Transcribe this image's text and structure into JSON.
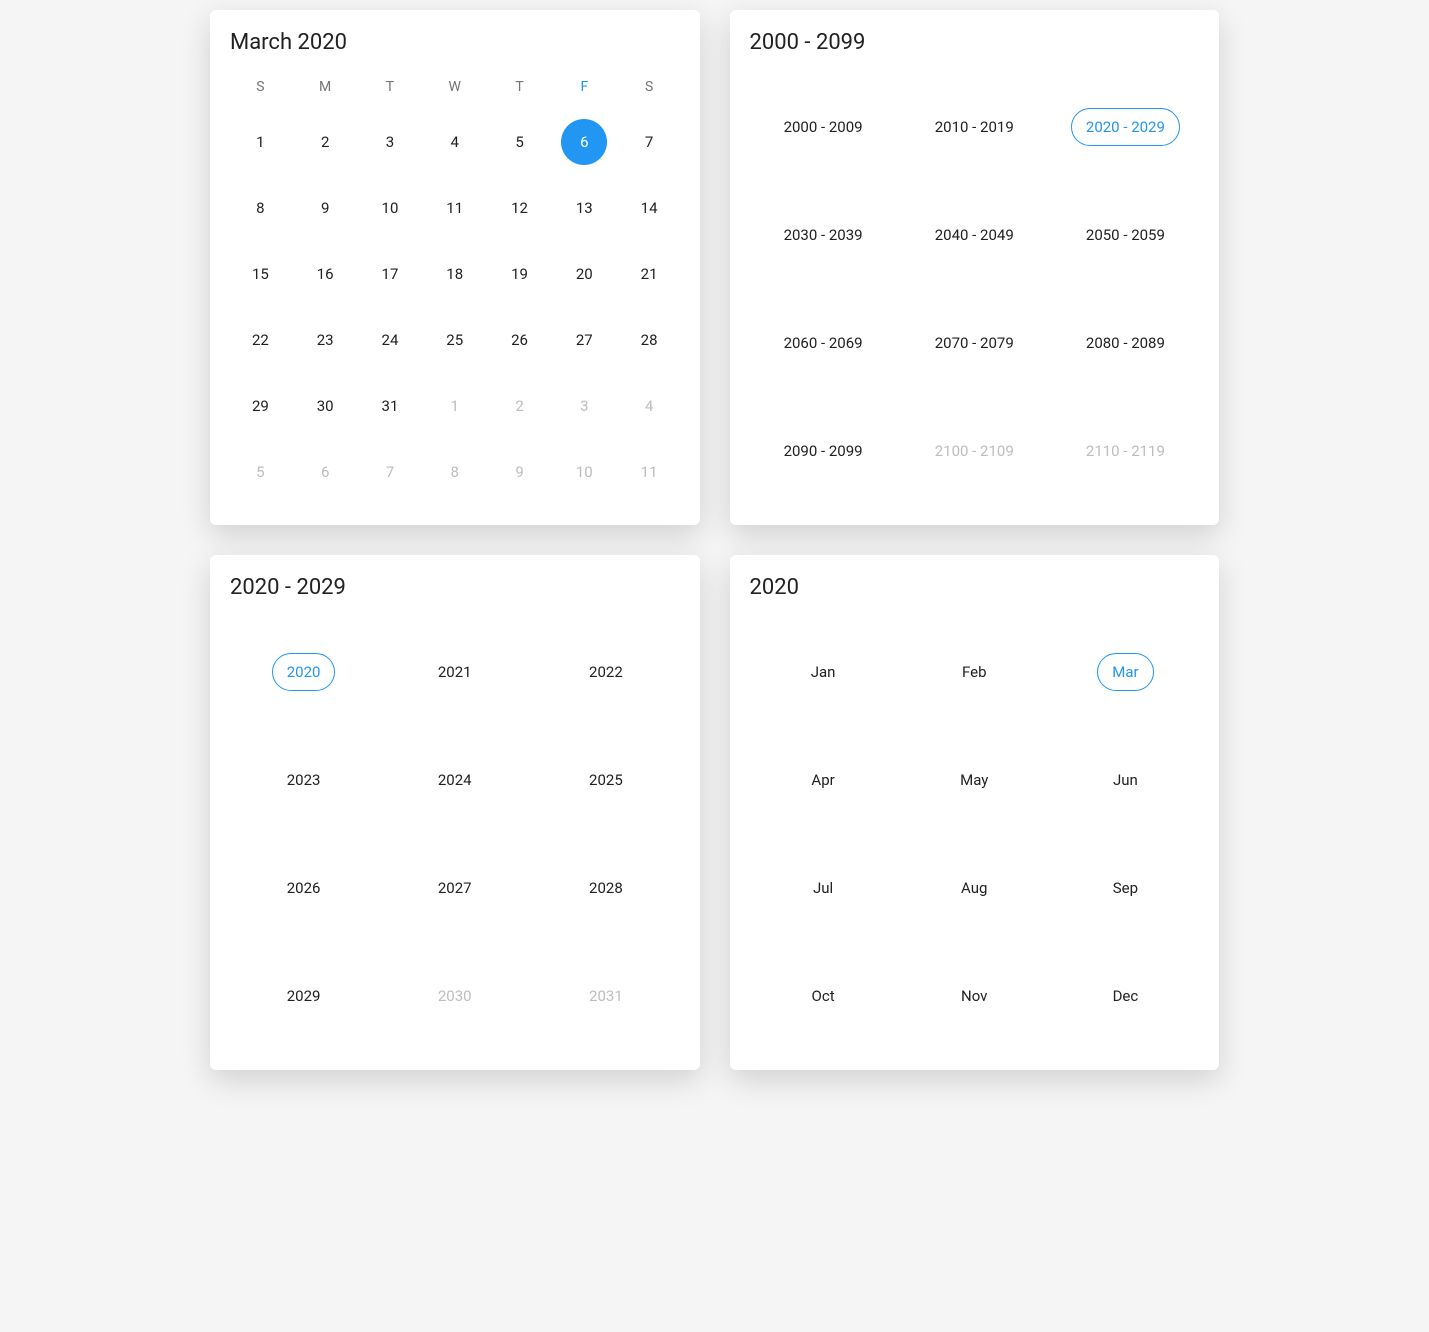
{
  "colors": {
    "accent": "#2196F3"
  },
  "dayView": {
    "title": "March 2020",
    "weekdays": [
      "S",
      "M",
      "T",
      "W",
      "T",
      "F",
      "S"
    ],
    "highlightWeekdayIndex": 5,
    "days": [
      {
        "n": "1"
      },
      {
        "n": "2"
      },
      {
        "n": "3"
      },
      {
        "n": "4"
      },
      {
        "n": "5"
      },
      {
        "n": "6",
        "selected": true
      },
      {
        "n": "7"
      },
      {
        "n": "8"
      },
      {
        "n": "9"
      },
      {
        "n": "10"
      },
      {
        "n": "11"
      },
      {
        "n": "12"
      },
      {
        "n": "13"
      },
      {
        "n": "14"
      },
      {
        "n": "15"
      },
      {
        "n": "16"
      },
      {
        "n": "17"
      },
      {
        "n": "18"
      },
      {
        "n": "19"
      },
      {
        "n": "20"
      },
      {
        "n": "21"
      },
      {
        "n": "22"
      },
      {
        "n": "23"
      },
      {
        "n": "24"
      },
      {
        "n": "25"
      },
      {
        "n": "26"
      },
      {
        "n": "27"
      },
      {
        "n": "28"
      },
      {
        "n": "29"
      },
      {
        "n": "30"
      },
      {
        "n": "31"
      },
      {
        "n": "1",
        "other": true
      },
      {
        "n": "2",
        "other": true
      },
      {
        "n": "3",
        "other": true
      },
      {
        "n": "4",
        "other": true
      },
      {
        "n": "5",
        "other": true
      },
      {
        "n": "6",
        "other": true
      },
      {
        "n": "7",
        "other": true
      },
      {
        "n": "8",
        "other": true
      },
      {
        "n": "9",
        "other": true
      },
      {
        "n": "10",
        "other": true
      },
      {
        "n": "11",
        "other": true
      }
    ]
  },
  "centuryView": {
    "title": "2000 - 2099",
    "cells": [
      {
        "label": "2000 - 2009"
      },
      {
        "label": "2010 - 2019"
      },
      {
        "label": "2020 - 2029",
        "selected": true
      },
      {
        "label": "2030 - 2039"
      },
      {
        "label": "2040 - 2049"
      },
      {
        "label": "2050 - 2059"
      },
      {
        "label": "2060 - 2069"
      },
      {
        "label": "2070 - 2079"
      },
      {
        "label": "2080 - 2089"
      },
      {
        "label": "2090 - 2099"
      },
      {
        "label": "2100 - 2109",
        "disabled": true
      },
      {
        "label": "2110 - 2119",
        "disabled": true
      }
    ]
  },
  "decadeView": {
    "title": "2020 - 2029",
    "cells": [
      {
        "label": "2020",
        "selected": true
      },
      {
        "label": "2021"
      },
      {
        "label": "2022"
      },
      {
        "label": "2023"
      },
      {
        "label": "2024"
      },
      {
        "label": "2025"
      },
      {
        "label": "2026"
      },
      {
        "label": "2027"
      },
      {
        "label": "2028"
      },
      {
        "label": "2029"
      },
      {
        "label": "2030",
        "disabled": true
      },
      {
        "label": "2031",
        "disabled": true
      }
    ]
  },
  "monthView": {
    "title": "2020",
    "cells": [
      {
        "label": "Jan"
      },
      {
        "label": "Feb"
      },
      {
        "label": "Mar",
        "selected": true
      },
      {
        "label": "Apr"
      },
      {
        "label": "May"
      },
      {
        "label": "Jun"
      },
      {
        "label": "Jul"
      },
      {
        "label": "Aug"
      },
      {
        "label": "Sep"
      },
      {
        "label": "Oct"
      },
      {
        "label": "Nov"
      },
      {
        "label": "Dec"
      }
    ]
  }
}
